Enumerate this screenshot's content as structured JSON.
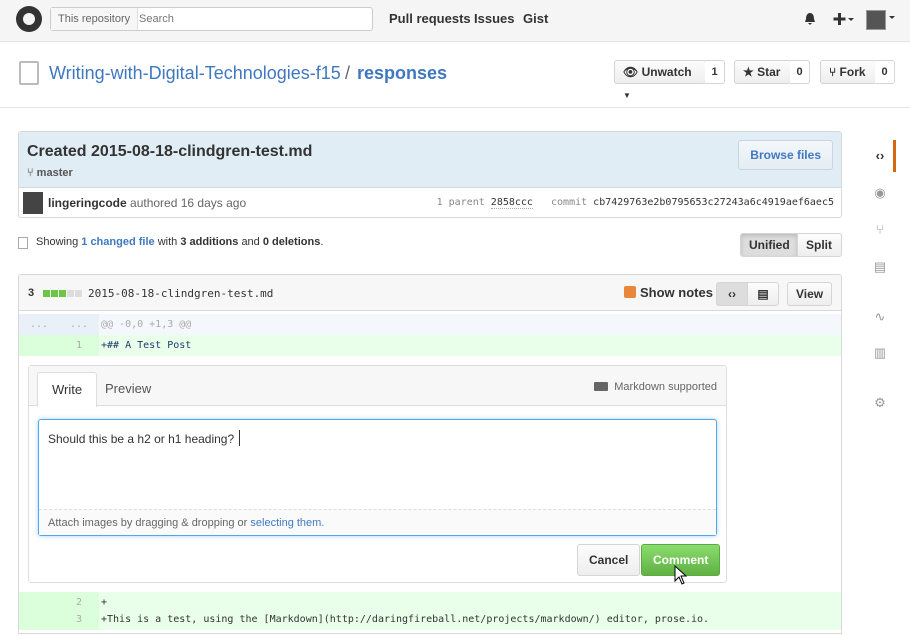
{
  "header": {
    "search_scope": "This repository",
    "search_placeholder": "Search",
    "nav": [
      "Pull requests",
      "Issues",
      "Gist"
    ],
    "icons": [
      "github-logo-icon",
      "bell-icon",
      "plus-icon",
      "avatar"
    ]
  },
  "repo": {
    "owner": "Writing-with-Digital-Technologies-f15",
    "separator": "/",
    "name": "responses",
    "watch_label": "Unwatch",
    "watch_count": "1",
    "star_label": "Star",
    "star_count": "0",
    "fork_label": "Fork",
    "fork_count": "0"
  },
  "commit": {
    "title": "Created 2015-08-18-clindgren-test.md",
    "branch": "master",
    "browse_label": "Browse files",
    "author": "lingeringcode",
    "authored": "authored 16 days ago",
    "parent_label": "1 parent",
    "parent_sha": "2858ccc",
    "commit_label": "commit",
    "commit_sha": "cb7429763e2b0795653c27243a6c4919aef6aec5"
  },
  "toc": {
    "showing": "Showing",
    "changed": "1 changed file",
    "with": "with",
    "additions": "3 additions",
    "and": "and",
    "deletions": "0 deletions",
    "period": ".",
    "unified_label": "Unified",
    "split_label": "Split"
  },
  "file": {
    "count": "3",
    "name": "2015-08-18-clindgren-test.md",
    "show_notes": "Show notes",
    "view_label": "View",
    "hunk": "@@ -0,0 +1,3 @@",
    "hunk_old": "...",
    "hunk_new": "...",
    "lines": [
      {
        "new": "1",
        "code": "+## A Test Post"
      },
      {
        "new": "2",
        "code": "+"
      },
      {
        "new": "3",
        "code": "+This is a test, using the [Markdown](http://daringfireball.net/projects/markdown/) editor, prose.io."
      }
    ]
  },
  "comment_form": {
    "tab_write": "Write",
    "tab_preview": "Preview",
    "markdown_note": "Markdown supported",
    "text": "Should this be a h2 or h1 heading?",
    "attach_prefix": "Attach images by dragging & dropping or",
    "attach_link": "selecting them.",
    "cancel_label": "Cancel",
    "comment_label": "Comment"
  },
  "colors": {
    "link": "#4078c0",
    "addition": "#6cc644",
    "comment_button": "#60b044",
    "commit_header": "#e1edf5",
    "added_line": "#eaffea"
  },
  "sidebar_icons": [
    "code-icon",
    "issue-icon",
    "pull-request-icon",
    "wiki-icon",
    "pulse-icon",
    "graph-icon",
    "settings-icon"
  ]
}
